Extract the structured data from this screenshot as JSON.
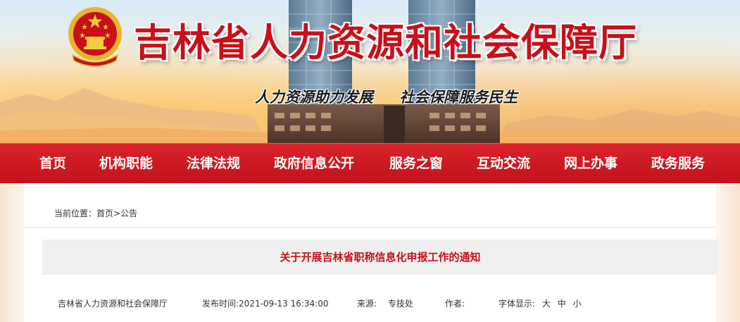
{
  "header": {
    "site_title": "吉林省人力资源和社会保障厅",
    "slogan_left": "人力资源助力发展",
    "slogan_right": "社会保障服务民生",
    "emblem_icon": "national-emblem-icon"
  },
  "nav": {
    "items": [
      {
        "label": "首页"
      },
      {
        "label": "机构职能"
      },
      {
        "label": "法律法规"
      },
      {
        "label": "政府信息公开"
      },
      {
        "label": "服务之窗"
      },
      {
        "label": "互动交流"
      },
      {
        "label": "网上办事"
      },
      {
        "label": "政务服务"
      }
    ]
  },
  "breadcrumb": {
    "prefix": "当前位置：",
    "home": "首页",
    "separator": ">",
    "current": "公告"
  },
  "article": {
    "title": "关于开展吉林省职称信息化申报工作的通知",
    "department": "吉林省人力资源和社会保障厅",
    "publish_label": "发布时间:",
    "publish_time": "2021-09-13 16:34:00",
    "source_label": "来源:",
    "source": "专技处",
    "author_label": "作者:",
    "author": "",
    "font_label": "字体显示:",
    "font_sizes": [
      "大",
      "中",
      "小"
    ]
  },
  "colors": {
    "brand_red": "#c8101a",
    "nav_red": "#d8232a",
    "title_bar_bg": "#efefef"
  }
}
